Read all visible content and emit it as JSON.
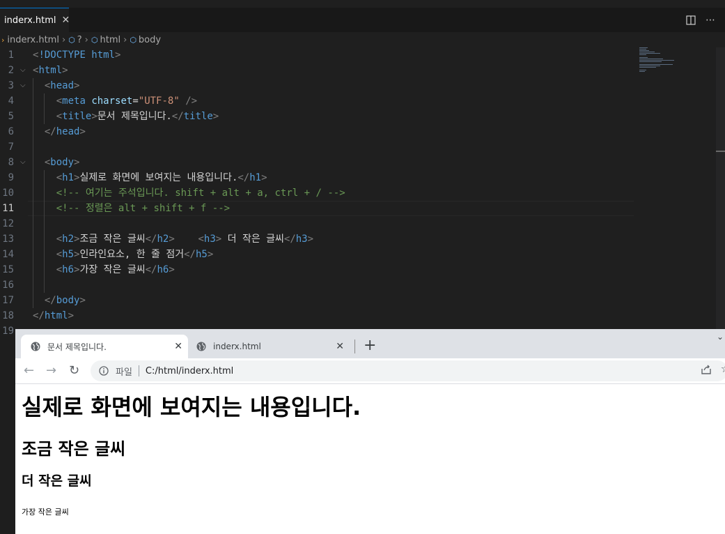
{
  "editor": {
    "tab_label": "inderx.html",
    "close_glyph": "✕",
    "breadcrumb": [
      "inderx.html",
      "?",
      "html",
      "body"
    ],
    "current_line": 11,
    "lines": [
      {
        "n": 1,
        "tokens": [
          [
            "brk",
            "<"
          ],
          [
            "doctype",
            "!DOCTYPE html"
          ],
          [
            "brk",
            ">"
          ]
        ]
      },
      {
        "n": 2,
        "tokens": [
          [
            "brk",
            "<"
          ],
          [
            "tag",
            "html"
          ],
          [
            "brk",
            ">"
          ]
        ]
      },
      {
        "n": 3,
        "tokens": [
          [
            "txt",
            "  "
          ],
          [
            "brk",
            "<"
          ],
          [
            "tag",
            "head"
          ],
          [
            "brk",
            ">"
          ]
        ]
      },
      {
        "n": 4,
        "tokens": [
          [
            "txt",
            "    "
          ],
          [
            "brk",
            "<"
          ],
          [
            "tag",
            "meta"
          ],
          [
            "txt",
            " "
          ],
          [
            "attr",
            "charset"
          ],
          [
            "txt",
            "="
          ],
          [
            "str",
            "\"UTF-8\""
          ],
          [
            "txt",
            " "
          ],
          [
            "brk",
            "/>"
          ]
        ]
      },
      {
        "n": 5,
        "tokens": [
          [
            "txt",
            "    "
          ],
          [
            "brk",
            "<"
          ],
          [
            "tag",
            "title"
          ],
          [
            "brk",
            ">"
          ],
          [
            "txt",
            "문서 제목입니다."
          ],
          [
            "brk",
            "</"
          ],
          [
            "tag",
            "title"
          ],
          [
            "brk",
            ">"
          ]
        ]
      },
      {
        "n": 6,
        "tokens": [
          [
            "txt",
            "  "
          ],
          [
            "brk",
            "</"
          ],
          [
            "tag",
            "head"
          ],
          [
            "brk",
            ">"
          ]
        ]
      },
      {
        "n": 7,
        "tokens": []
      },
      {
        "n": 8,
        "tokens": [
          [
            "txt",
            "  "
          ],
          [
            "brk",
            "<"
          ],
          [
            "tag",
            "body"
          ],
          [
            "brk",
            ">"
          ]
        ]
      },
      {
        "n": 9,
        "tokens": [
          [
            "txt",
            "    "
          ],
          [
            "brk",
            "<"
          ],
          [
            "tag",
            "h1"
          ],
          [
            "brk",
            ">"
          ],
          [
            "txt",
            "실제로 화면에 보여지는 내용입니다."
          ],
          [
            "brk",
            "</"
          ],
          [
            "tag",
            "h1"
          ],
          [
            "brk",
            ">"
          ]
        ]
      },
      {
        "n": 10,
        "tokens": [
          [
            "txt",
            "    "
          ],
          [
            "cmt",
            "<!-- 여기는 주석입니다. shift + alt + a, ctrl + / -->"
          ]
        ]
      },
      {
        "n": 11,
        "tokens": [
          [
            "txt",
            "    "
          ],
          [
            "cmt",
            "<!-- 정렬은 alt + shift + f -->"
          ]
        ]
      },
      {
        "n": 12,
        "tokens": []
      },
      {
        "n": 13,
        "tokens": [
          [
            "txt",
            "    "
          ],
          [
            "brk",
            "<"
          ],
          [
            "tag",
            "h2"
          ],
          [
            "brk",
            ">"
          ],
          [
            "txt",
            "조금 작은 글씨"
          ],
          [
            "brk",
            "</"
          ],
          [
            "tag",
            "h2"
          ],
          [
            "brk",
            ">"
          ],
          [
            "txt",
            "    "
          ],
          [
            "brk",
            "<"
          ],
          [
            "tag",
            "h3"
          ],
          [
            "brk",
            ">"
          ],
          [
            "txt",
            " 더 작은 글씨"
          ],
          [
            "brk",
            "</"
          ],
          [
            "tag",
            "h3"
          ],
          [
            "brk",
            ">"
          ]
        ]
      },
      {
        "n": 14,
        "tokens": [
          [
            "txt",
            "    "
          ],
          [
            "brk",
            "<"
          ],
          [
            "tag",
            "h5"
          ],
          [
            "brk",
            ">"
          ],
          [
            "txt",
            "인라인요소, 한 줄 점거"
          ],
          [
            "brk",
            "</"
          ],
          [
            "tag",
            "h5"
          ],
          [
            "brk",
            ">"
          ]
        ]
      },
      {
        "n": 15,
        "tokens": [
          [
            "txt",
            "    "
          ],
          [
            "brk",
            "<"
          ],
          [
            "tag",
            "h6"
          ],
          [
            "brk",
            ">"
          ],
          [
            "txt",
            "가장 작은 글씨"
          ],
          [
            "brk",
            "</"
          ],
          [
            "tag",
            "h6"
          ],
          [
            "brk",
            ">"
          ]
        ]
      },
      {
        "n": 16,
        "tokens": []
      },
      {
        "n": 17,
        "tokens": [
          [
            "txt",
            "  "
          ],
          [
            "brk",
            "</"
          ],
          [
            "tag",
            "body"
          ],
          [
            "brk",
            ">"
          ]
        ]
      },
      {
        "n": 18,
        "tokens": [
          [
            "brk",
            "</"
          ],
          [
            "tag",
            "html"
          ],
          [
            "brk",
            ">"
          ]
        ]
      },
      {
        "n": 19,
        "tokens": []
      }
    ],
    "folds": [
      2,
      3,
      8
    ]
  },
  "browser": {
    "tabs": [
      {
        "title": "문서 제목입니다.",
        "icon": "globe-icon",
        "active": true
      },
      {
        "title": "inderx.html",
        "icon": "globe-icon",
        "active": false
      }
    ],
    "new_tab_glyph": "+",
    "address": {
      "scheme_label": "파일",
      "url": "C:/html/inderx.html"
    },
    "page": {
      "h1": "실제로 화면에 보여지는 내용입니다.",
      "h2": "조금 작은 글씨",
      "h3": "더 작은 글씨",
      "h6": "가장 작은 글씨"
    }
  },
  "colors": {
    "tag": "#569cd6",
    "comment": "#6a9955",
    "string": "#ce9178",
    "attribute": "#9cdcfe",
    "accent": "#0078d4"
  }
}
